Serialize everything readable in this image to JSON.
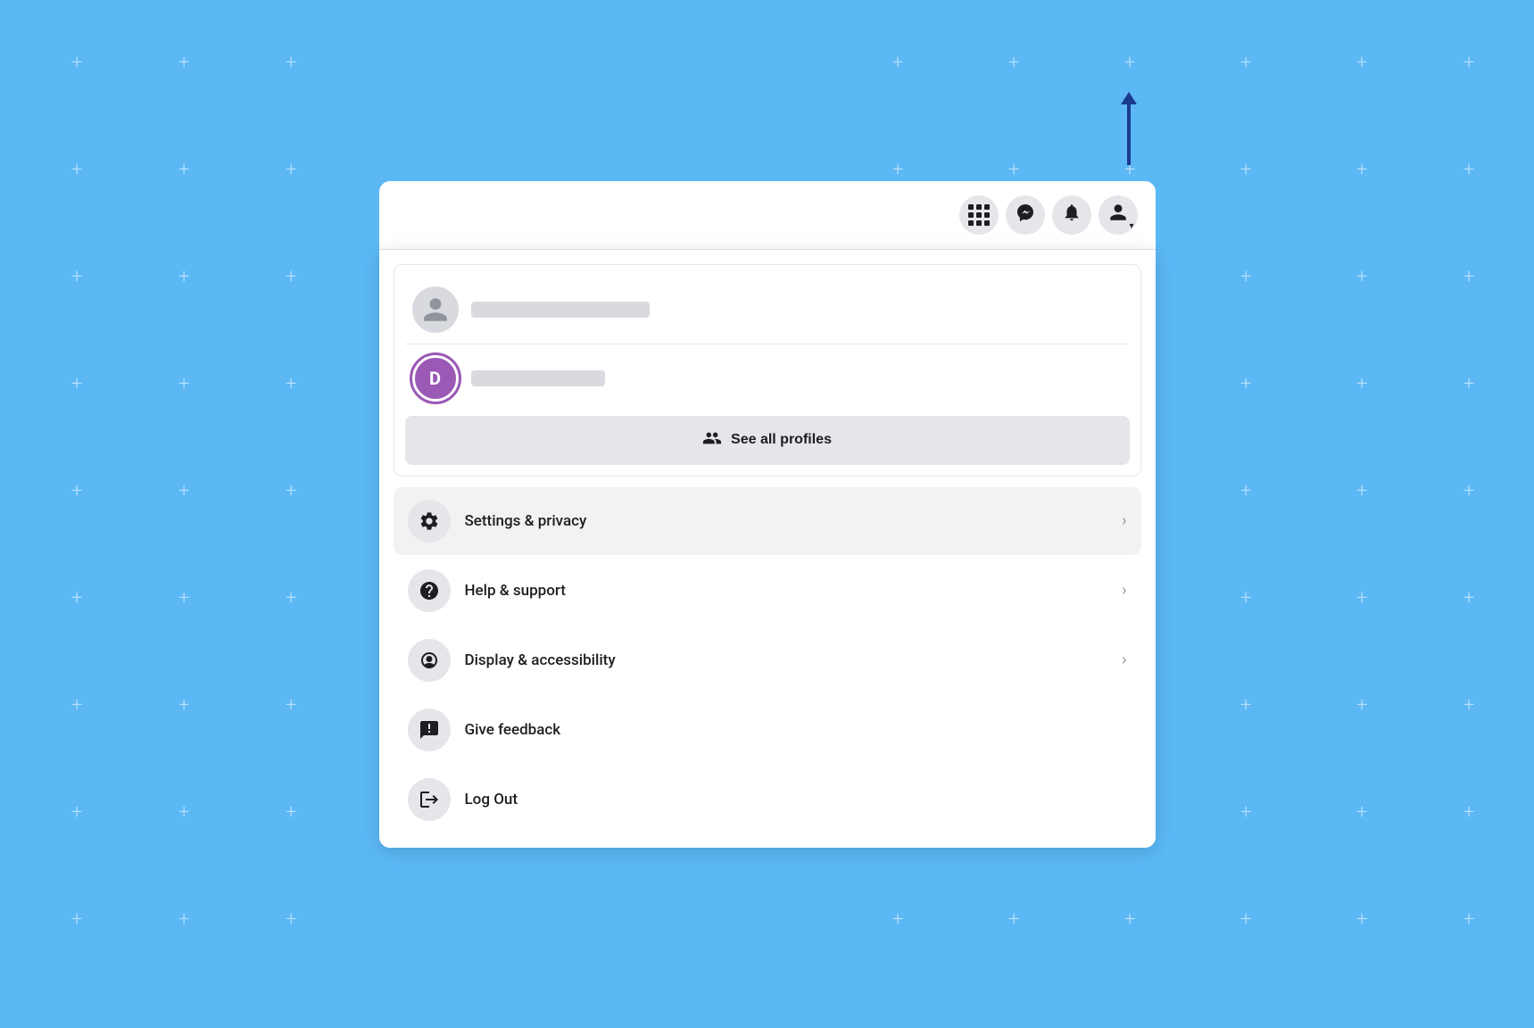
{
  "background": {
    "color": "#5bb8f5"
  },
  "nav": {
    "icons": [
      {
        "name": "grid-icon",
        "symbol": "⊞",
        "label": "Menu"
      },
      {
        "name": "messenger-icon",
        "symbol": "✉",
        "label": "Messenger"
      },
      {
        "name": "notifications-icon",
        "symbol": "🔔",
        "label": "Notifications"
      },
      {
        "name": "account-icon",
        "symbol": "👤",
        "label": "Account"
      }
    ]
  },
  "profiles": {
    "items": [
      {
        "id": "profile-1",
        "avatar_type": "default",
        "avatar_letter": "",
        "name_placeholder": true
      },
      {
        "id": "profile-2",
        "avatar_type": "letter",
        "avatar_letter": "D",
        "name_placeholder": true
      }
    ],
    "see_all_label": "See all profiles"
  },
  "menu": {
    "items": [
      {
        "id": "settings-privacy",
        "label": "Settings & privacy",
        "icon": "gear",
        "has_chevron": true,
        "active": true
      },
      {
        "id": "help-support",
        "label": "Help & support",
        "icon": "question",
        "has_chevron": true,
        "active": false
      },
      {
        "id": "display-accessibility",
        "label": "Display & accessibility",
        "icon": "moon",
        "has_chevron": true,
        "active": false
      },
      {
        "id": "give-feedback",
        "label": "Give feedback",
        "icon": "flag",
        "has_chevron": false,
        "active": false
      },
      {
        "id": "log-out",
        "label": "Log Out",
        "icon": "logout",
        "has_chevron": false,
        "active": false
      }
    ]
  }
}
